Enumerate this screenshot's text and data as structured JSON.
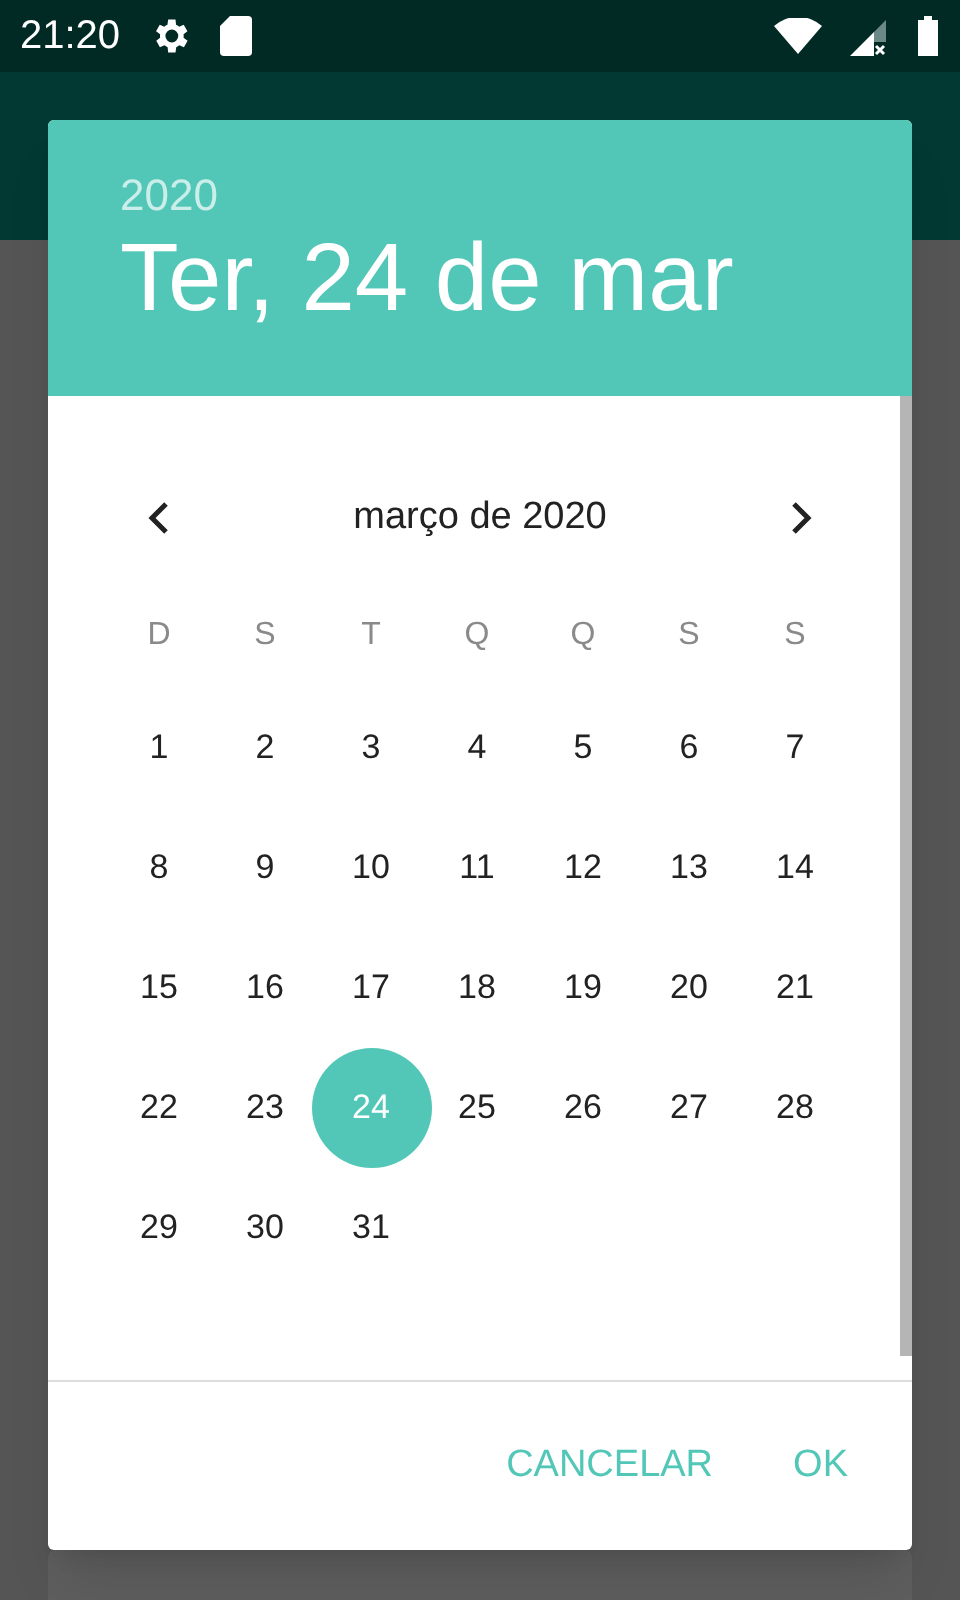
{
  "status_bar": {
    "time": "21:20"
  },
  "date_picker": {
    "year": "2020",
    "date": "Ter, 24 de mar",
    "month": "março de 2020",
    "weekdays": [
      "D",
      "S",
      "T",
      "Q",
      "Q",
      "S",
      "S"
    ],
    "days": [
      {
        "label": "1",
        "selected": false
      },
      {
        "label": "2",
        "selected": false
      },
      {
        "label": "3",
        "selected": false
      },
      {
        "label": "4",
        "selected": false
      },
      {
        "label": "5",
        "selected": false
      },
      {
        "label": "6",
        "selected": false
      },
      {
        "label": "7",
        "selected": false
      },
      {
        "label": "8",
        "selected": false
      },
      {
        "label": "9",
        "selected": false
      },
      {
        "label": "10",
        "selected": false
      },
      {
        "label": "11",
        "selected": false
      },
      {
        "label": "12",
        "selected": false
      },
      {
        "label": "13",
        "selected": false
      },
      {
        "label": "14",
        "selected": false
      },
      {
        "label": "15",
        "selected": false
      },
      {
        "label": "16",
        "selected": false
      },
      {
        "label": "17",
        "selected": false
      },
      {
        "label": "18",
        "selected": false
      },
      {
        "label": "19",
        "selected": false
      },
      {
        "label": "20",
        "selected": false
      },
      {
        "label": "21",
        "selected": false
      },
      {
        "label": "22",
        "selected": false
      },
      {
        "label": "23",
        "selected": false
      },
      {
        "label": "24",
        "selected": true
      },
      {
        "label": "25",
        "selected": false
      },
      {
        "label": "26",
        "selected": false
      },
      {
        "label": "27",
        "selected": false
      },
      {
        "label": "28",
        "selected": false
      },
      {
        "label": "29",
        "selected": false
      },
      {
        "label": "30",
        "selected": false
      },
      {
        "label": "31",
        "selected": false
      }
    ],
    "buttons": [
      {
        "label": "CANCELAR"
      },
      {
        "label": "OK"
      }
    ]
  }
}
